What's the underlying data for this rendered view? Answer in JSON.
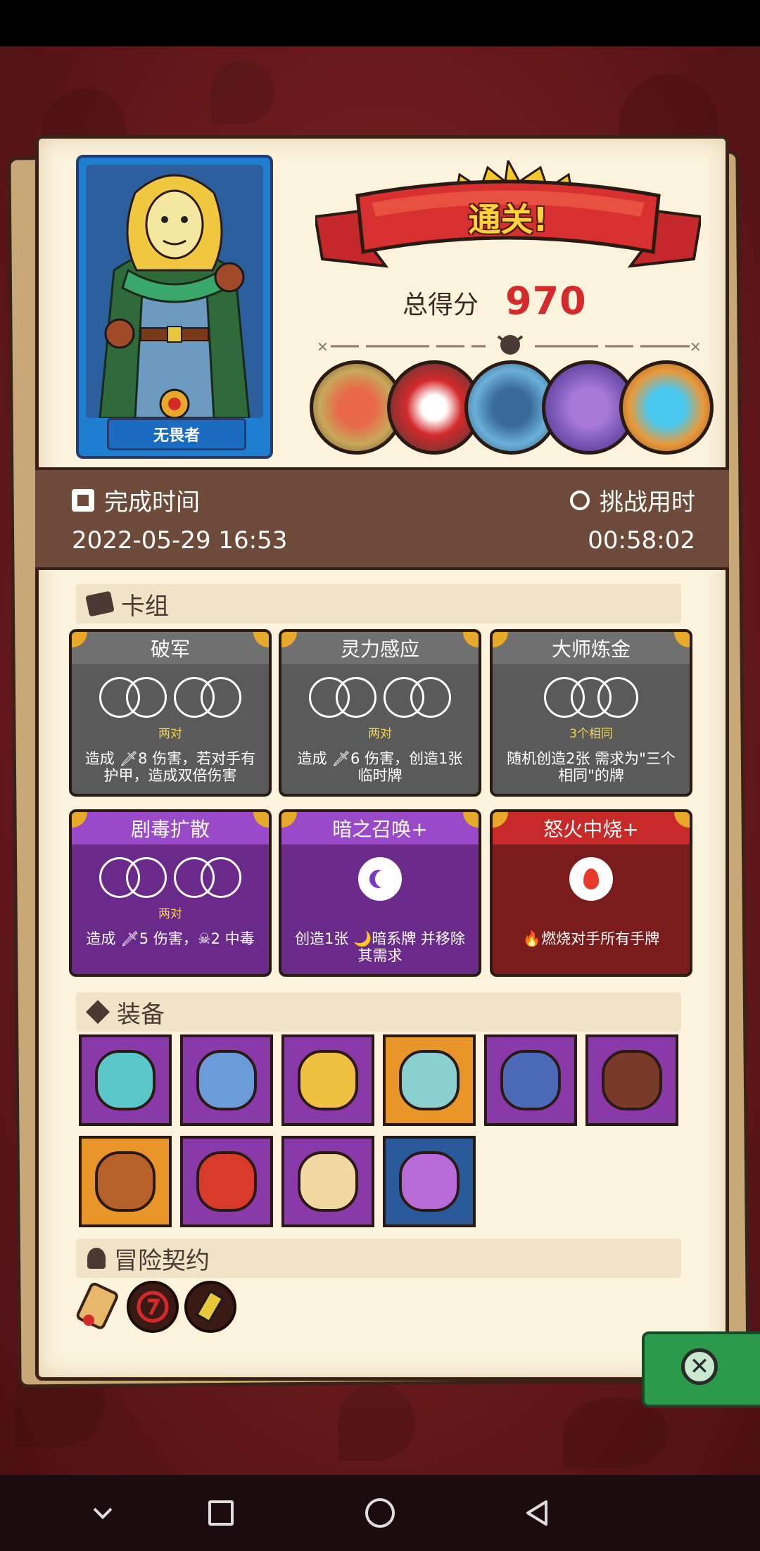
{
  "result": {
    "banner_text": "通关!",
    "score_label": "总得分",
    "score_value": "970"
  },
  "hero": {
    "name": "无畏者"
  },
  "bosses": [
    "eye-monster-boss",
    "caged-red-beast-boss",
    "armored-knight-boss",
    "purple-dragon-boss",
    "crystal-golem-boss"
  ],
  "time": {
    "finish_label": "完成时间",
    "finish_value": "2022-05-29 16:53",
    "challenge_label": "挑战用时",
    "challenge_value": "00:58:02"
  },
  "deck": {
    "heading": "卡组",
    "cards": [
      {
        "title": "破军",
        "sub": "两对",
        "desc": "造成 🗡8 伤害，若对手有护甲，造成双倍伤害",
        "color": "gray"
      },
      {
        "title": "灵力感应",
        "sub": "两对",
        "desc": "造成 🗡6 伤害，创造1张临时牌",
        "color": "gray"
      },
      {
        "title": "大师炼金",
        "sub": "3个相同",
        "desc": "随机创造2张 需求为\"三个相同\"的牌",
        "color": "gray"
      },
      {
        "title": "剧毒扩散",
        "sub": "两对",
        "desc": "造成 🗡5 伤害，☠2 中毒",
        "color": "purple"
      },
      {
        "title": "暗之召唤+",
        "sub": "",
        "desc": "创造1张 🌙暗系牌 并移除其需求",
        "color": "purple"
      },
      {
        "title": "怒火中烧+",
        "sub": "",
        "desc": "🔥燃烧对手所有手牌",
        "color": "red"
      }
    ]
  },
  "equipment": {
    "heading": "装备",
    "items": [
      {
        "name": "demon-mask-icon",
        "bg": "#8a3aa8"
      },
      {
        "name": "ring-icon",
        "bg": "#8a3aa8"
      },
      {
        "name": "glove-icon",
        "bg": "#8a3aa8"
      },
      {
        "name": "vase-icon",
        "bg": "#e8962a"
      },
      {
        "name": "crown-helm-icon",
        "bg": "#8a3aa8"
      },
      {
        "name": "button-icon",
        "bg": "#8a3aa8"
      },
      {
        "name": "flame-wood-icon",
        "bg": "#e8962a"
      },
      {
        "name": "red-bracer-icon",
        "bg": "#8a3aa8"
      },
      {
        "name": "sun-face-icon",
        "bg": "#8a3aa8"
      },
      {
        "name": "potion-jug-icon",
        "bg": "#2a5a9a"
      }
    ]
  },
  "contracts": {
    "heading": "冒险契约"
  },
  "colors": {
    "panel": "#fbf3dc",
    "score": "#d42a2a",
    "time_bar": "#6d4a3a"
  }
}
